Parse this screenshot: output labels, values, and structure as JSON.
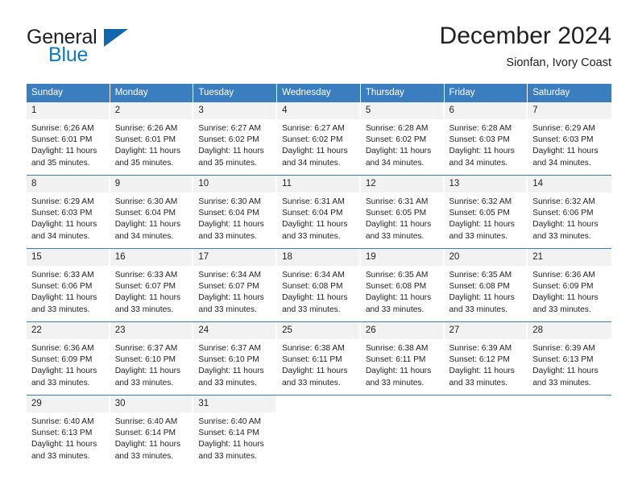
{
  "logo": {
    "primary_text": "General",
    "secondary_text": "Blue",
    "primary_color": "#231f20",
    "secondary_color": "#1278be",
    "triangle_color": "#1067ab"
  },
  "header": {
    "title": "December 2024",
    "location": "Sionfan, Ivory Coast"
  },
  "theme": {
    "header_bg": "#3a7ebf",
    "header_text": "#ffffff",
    "daynum_bg": "#f2f2f2",
    "grid_line": "#3a7ebf",
    "body_text": "#231f20"
  },
  "calendar": {
    "weekday_headers": [
      "Sunday",
      "Monday",
      "Tuesday",
      "Wednesday",
      "Thursday",
      "Friday",
      "Saturday"
    ],
    "weeks": [
      [
        {
          "day": "1",
          "sunrise": "Sunrise: 6:26 AM",
          "sunset": "Sunset: 6:01 PM",
          "daylight_1": "Daylight: 11 hours",
          "daylight_2": "and 35 minutes."
        },
        {
          "day": "2",
          "sunrise": "Sunrise: 6:26 AM",
          "sunset": "Sunset: 6:01 PM",
          "daylight_1": "Daylight: 11 hours",
          "daylight_2": "and 35 minutes."
        },
        {
          "day": "3",
          "sunrise": "Sunrise: 6:27 AM",
          "sunset": "Sunset: 6:02 PM",
          "daylight_1": "Daylight: 11 hours",
          "daylight_2": "and 35 minutes."
        },
        {
          "day": "4",
          "sunrise": "Sunrise: 6:27 AM",
          "sunset": "Sunset: 6:02 PM",
          "daylight_1": "Daylight: 11 hours",
          "daylight_2": "and 34 minutes."
        },
        {
          "day": "5",
          "sunrise": "Sunrise: 6:28 AM",
          "sunset": "Sunset: 6:02 PM",
          "daylight_1": "Daylight: 11 hours",
          "daylight_2": "and 34 minutes."
        },
        {
          "day": "6",
          "sunrise": "Sunrise: 6:28 AM",
          "sunset": "Sunset: 6:03 PM",
          "daylight_1": "Daylight: 11 hours",
          "daylight_2": "and 34 minutes."
        },
        {
          "day": "7",
          "sunrise": "Sunrise: 6:29 AM",
          "sunset": "Sunset: 6:03 PM",
          "daylight_1": "Daylight: 11 hours",
          "daylight_2": "and 34 minutes."
        }
      ],
      [
        {
          "day": "8",
          "sunrise": "Sunrise: 6:29 AM",
          "sunset": "Sunset: 6:03 PM",
          "daylight_1": "Daylight: 11 hours",
          "daylight_2": "and 34 minutes."
        },
        {
          "day": "9",
          "sunrise": "Sunrise: 6:30 AM",
          "sunset": "Sunset: 6:04 PM",
          "daylight_1": "Daylight: 11 hours",
          "daylight_2": "and 34 minutes."
        },
        {
          "day": "10",
          "sunrise": "Sunrise: 6:30 AM",
          "sunset": "Sunset: 6:04 PM",
          "daylight_1": "Daylight: 11 hours",
          "daylight_2": "and 33 minutes."
        },
        {
          "day": "11",
          "sunrise": "Sunrise: 6:31 AM",
          "sunset": "Sunset: 6:04 PM",
          "daylight_1": "Daylight: 11 hours",
          "daylight_2": "and 33 minutes."
        },
        {
          "day": "12",
          "sunrise": "Sunrise: 6:31 AM",
          "sunset": "Sunset: 6:05 PM",
          "daylight_1": "Daylight: 11 hours",
          "daylight_2": "and 33 minutes."
        },
        {
          "day": "13",
          "sunrise": "Sunrise: 6:32 AM",
          "sunset": "Sunset: 6:05 PM",
          "daylight_1": "Daylight: 11 hours",
          "daylight_2": "and 33 minutes."
        },
        {
          "day": "14",
          "sunrise": "Sunrise: 6:32 AM",
          "sunset": "Sunset: 6:06 PM",
          "daylight_1": "Daylight: 11 hours",
          "daylight_2": "and 33 minutes."
        }
      ],
      [
        {
          "day": "15",
          "sunrise": "Sunrise: 6:33 AM",
          "sunset": "Sunset: 6:06 PM",
          "daylight_1": "Daylight: 11 hours",
          "daylight_2": "and 33 minutes."
        },
        {
          "day": "16",
          "sunrise": "Sunrise: 6:33 AM",
          "sunset": "Sunset: 6:07 PM",
          "daylight_1": "Daylight: 11 hours",
          "daylight_2": "and 33 minutes."
        },
        {
          "day": "17",
          "sunrise": "Sunrise: 6:34 AM",
          "sunset": "Sunset: 6:07 PM",
          "daylight_1": "Daylight: 11 hours",
          "daylight_2": "and 33 minutes."
        },
        {
          "day": "18",
          "sunrise": "Sunrise: 6:34 AM",
          "sunset": "Sunset: 6:08 PM",
          "daylight_1": "Daylight: 11 hours",
          "daylight_2": "and 33 minutes."
        },
        {
          "day": "19",
          "sunrise": "Sunrise: 6:35 AM",
          "sunset": "Sunset: 6:08 PM",
          "daylight_1": "Daylight: 11 hours",
          "daylight_2": "and 33 minutes."
        },
        {
          "day": "20",
          "sunrise": "Sunrise: 6:35 AM",
          "sunset": "Sunset: 6:08 PM",
          "daylight_1": "Daylight: 11 hours",
          "daylight_2": "and 33 minutes."
        },
        {
          "day": "21",
          "sunrise": "Sunrise: 6:36 AM",
          "sunset": "Sunset: 6:09 PM",
          "daylight_1": "Daylight: 11 hours",
          "daylight_2": "and 33 minutes."
        }
      ],
      [
        {
          "day": "22",
          "sunrise": "Sunrise: 6:36 AM",
          "sunset": "Sunset: 6:09 PM",
          "daylight_1": "Daylight: 11 hours",
          "daylight_2": "and 33 minutes."
        },
        {
          "day": "23",
          "sunrise": "Sunrise: 6:37 AM",
          "sunset": "Sunset: 6:10 PM",
          "daylight_1": "Daylight: 11 hours",
          "daylight_2": "and 33 minutes."
        },
        {
          "day": "24",
          "sunrise": "Sunrise: 6:37 AM",
          "sunset": "Sunset: 6:10 PM",
          "daylight_1": "Daylight: 11 hours",
          "daylight_2": "and 33 minutes."
        },
        {
          "day": "25",
          "sunrise": "Sunrise: 6:38 AM",
          "sunset": "Sunset: 6:11 PM",
          "daylight_1": "Daylight: 11 hours",
          "daylight_2": "and 33 minutes."
        },
        {
          "day": "26",
          "sunrise": "Sunrise: 6:38 AM",
          "sunset": "Sunset: 6:11 PM",
          "daylight_1": "Daylight: 11 hours",
          "daylight_2": "and 33 minutes."
        },
        {
          "day": "27",
          "sunrise": "Sunrise: 6:39 AM",
          "sunset": "Sunset: 6:12 PM",
          "daylight_1": "Daylight: 11 hours",
          "daylight_2": "and 33 minutes."
        },
        {
          "day": "28",
          "sunrise": "Sunrise: 6:39 AM",
          "sunset": "Sunset: 6:13 PM",
          "daylight_1": "Daylight: 11 hours",
          "daylight_2": "and 33 minutes."
        }
      ],
      [
        {
          "day": "29",
          "sunrise": "Sunrise: 6:40 AM",
          "sunset": "Sunset: 6:13 PM",
          "daylight_1": "Daylight: 11 hours",
          "daylight_2": "and 33 minutes."
        },
        {
          "day": "30",
          "sunrise": "Sunrise: 6:40 AM",
          "sunset": "Sunset: 6:14 PM",
          "daylight_1": "Daylight: 11 hours",
          "daylight_2": "and 33 minutes."
        },
        {
          "day": "31",
          "sunrise": "Sunrise: 6:40 AM",
          "sunset": "Sunset: 6:14 PM",
          "daylight_1": "Daylight: 11 hours",
          "daylight_2": "and 33 minutes."
        },
        {
          "day": "",
          "sunrise": "",
          "sunset": "",
          "daylight_1": "",
          "daylight_2": ""
        },
        {
          "day": "",
          "sunrise": "",
          "sunset": "",
          "daylight_1": "",
          "daylight_2": ""
        },
        {
          "day": "",
          "sunrise": "",
          "sunset": "",
          "daylight_1": "",
          "daylight_2": ""
        },
        {
          "day": "",
          "sunrise": "",
          "sunset": "",
          "daylight_1": "",
          "daylight_2": ""
        }
      ]
    ]
  }
}
